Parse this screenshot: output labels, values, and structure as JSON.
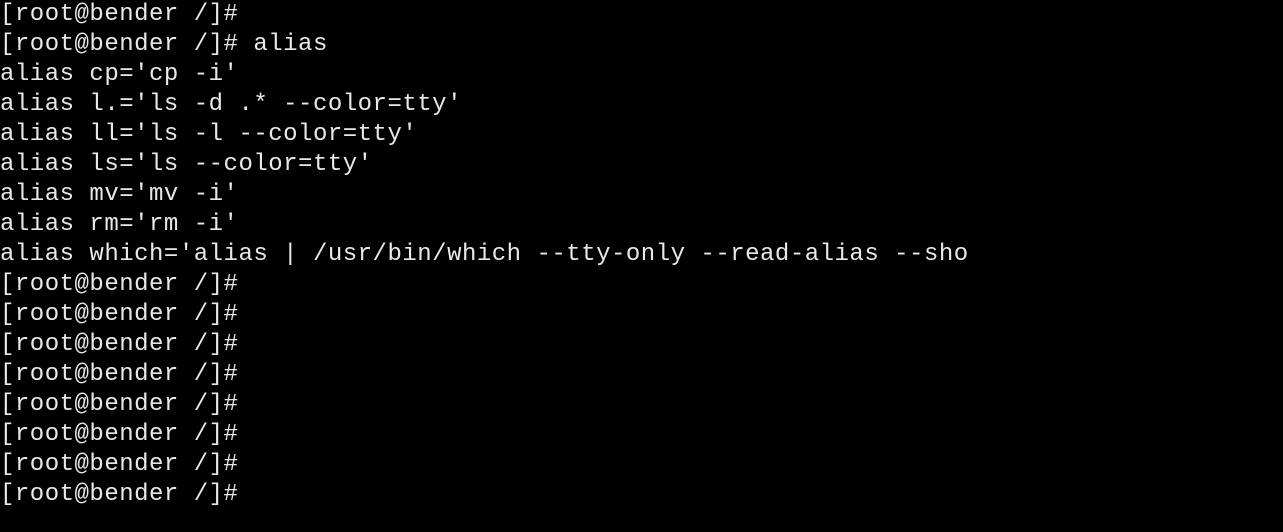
{
  "lines": [
    "[root@bender /]# ",
    "[root@bender /]# alias",
    "alias cp='cp -i'",
    "alias l.='ls -d .* --color=tty'",
    "alias ll='ls -l --color=tty'",
    "alias ls='ls --color=tty'",
    "alias mv='mv -i'",
    "alias rm='rm -i'",
    "alias which='alias | /usr/bin/which --tty-only --read-alias --sho",
    "[root@bender /]# ",
    "[root@bender /]# ",
    "[root@bender /]# ",
    "[root@bender /]# ",
    "[root@bender /]# ",
    "[root@bender /]# ",
    "[root@bender /]# ",
    "[root@bender /]# "
  ]
}
